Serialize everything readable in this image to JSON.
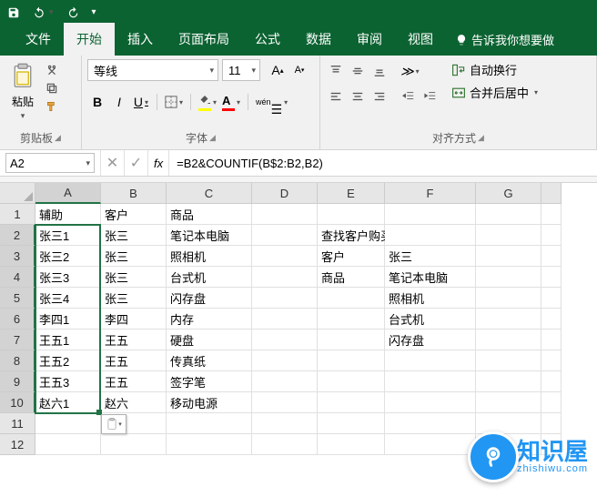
{
  "titlebar": {
    "save": "save-icon",
    "undo": "undo-icon",
    "redo": "redo-icon"
  },
  "tabs": {
    "file": "文件",
    "home": "开始",
    "insert": "插入",
    "layout": "页面布局",
    "formulas": "公式",
    "data": "数据",
    "review": "审阅",
    "view": "视图",
    "tellme": "告诉我你想要做"
  },
  "ribbon": {
    "clipboard": {
      "paste": "粘贴",
      "label": "剪贴板"
    },
    "font": {
      "name": "等线",
      "size": "11",
      "label": "字体"
    },
    "align": {
      "wrap": "自动换行",
      "merge": "合并后居中",
      "label": "对齐方式"
    }
  },
  "formula": {
    "cellref": "A2",
    "text": "=B2&COUNTIF(B$2:B2,B2)"
  },
  "columns": [
    "A",
    "B",
    "C",
    "D",
    "E",
    "F",
    "G"
  ],
  "rownums": [
    "1",
    "2",
    "3",
    "4",
    "5",
    "6",
    "7",
    "8",
    "9",
    "10",
    "11",
    "12"
  ],
  "grid": {
    "A": [
      "辅助",
      "张三1",
      "张三2",
      "张三3",
      "张三4",
      "李四1",
      "王五1",
      "王五2",
      "王五3",
      "赵六1",
      "",
      ""
    ],
    "B": [
      "客户",
      "张三",
      "张三",
      "张三",
      "张三",
      "李四",
      "王五",
      "王五",
      "王五",
      "赵六",
      "",
      ""
    ],
    "C": [
      "商品",
      "笔记本电脑",
      "照相机",
      "台式机",
      "闪存盘",
      "内存",
      "硬盘",
      "传真纸",
      "签字笔",
      "移动电源",
      "",
      ""
    ],
    "D": [
      "",
      "",
      "",
      "",
      "",
      "",
      "",
      "",
      "",
      "",
      "",
      ""
    ],
    "E": [
      "",
      "查找客户购买商品",
      "客户",
      "商品",
      "",
      "",
      "",
      "",
      "",
      "",
      "",
      ""
    ],
    "F": [
      "",
      "",
      "张三",
      "笔记本电脑",
      "照相机",
      "台式机",
      "闪存盘",
      "",
      "",
      "",
      "",
      ""
    ],
    "G": [
      "",
      "",
      "",
      "",
      "",
      "",
      "",
      "",
      "",
      "",
      "",
      ""
    ]
  },
  "watermark": {
    "cn": "知识屋",
    "en": "zhishiwu.com"
  }
}
